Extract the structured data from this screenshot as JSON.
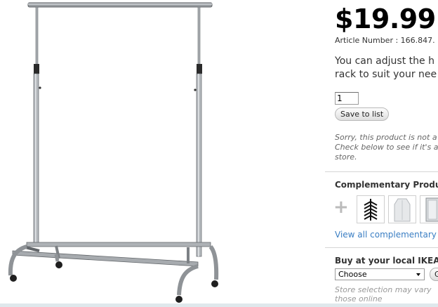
{
  "product": {
    "price": "$19.99",
    "article_number": "Article Number : 166.847.",
    "description_lines": [
      "You can adjust the h",
      "rack to suit your nee"
    ]
  },
  "purchase": {
    "quantity_value": "1",
    "save_label": "Save to list"
  },
  "availability": {
    "lines": [
      "Sorry, this product is not a",
      "Check below to see if it's a",
      "store."
    ]
  },
  "complementary": {
    "title": "Complementary Produc",
    "plus_icon": "+",
    "thumbnails": [
      "hanger-set-icon",
      "garment-bag-icon",
      "storage-case-icon"
    ],
    "view_all_label": "View all complementary p",
    "link_color": "#3a7ec3"
  },
  "local_store": {
    "title": "Buy at your local IKEA",
    "select_value": "Choose",
    "go_label": "G",
    "note_lines": [
      "Store selection may vary",
      "those online"
    ]
  }
}
